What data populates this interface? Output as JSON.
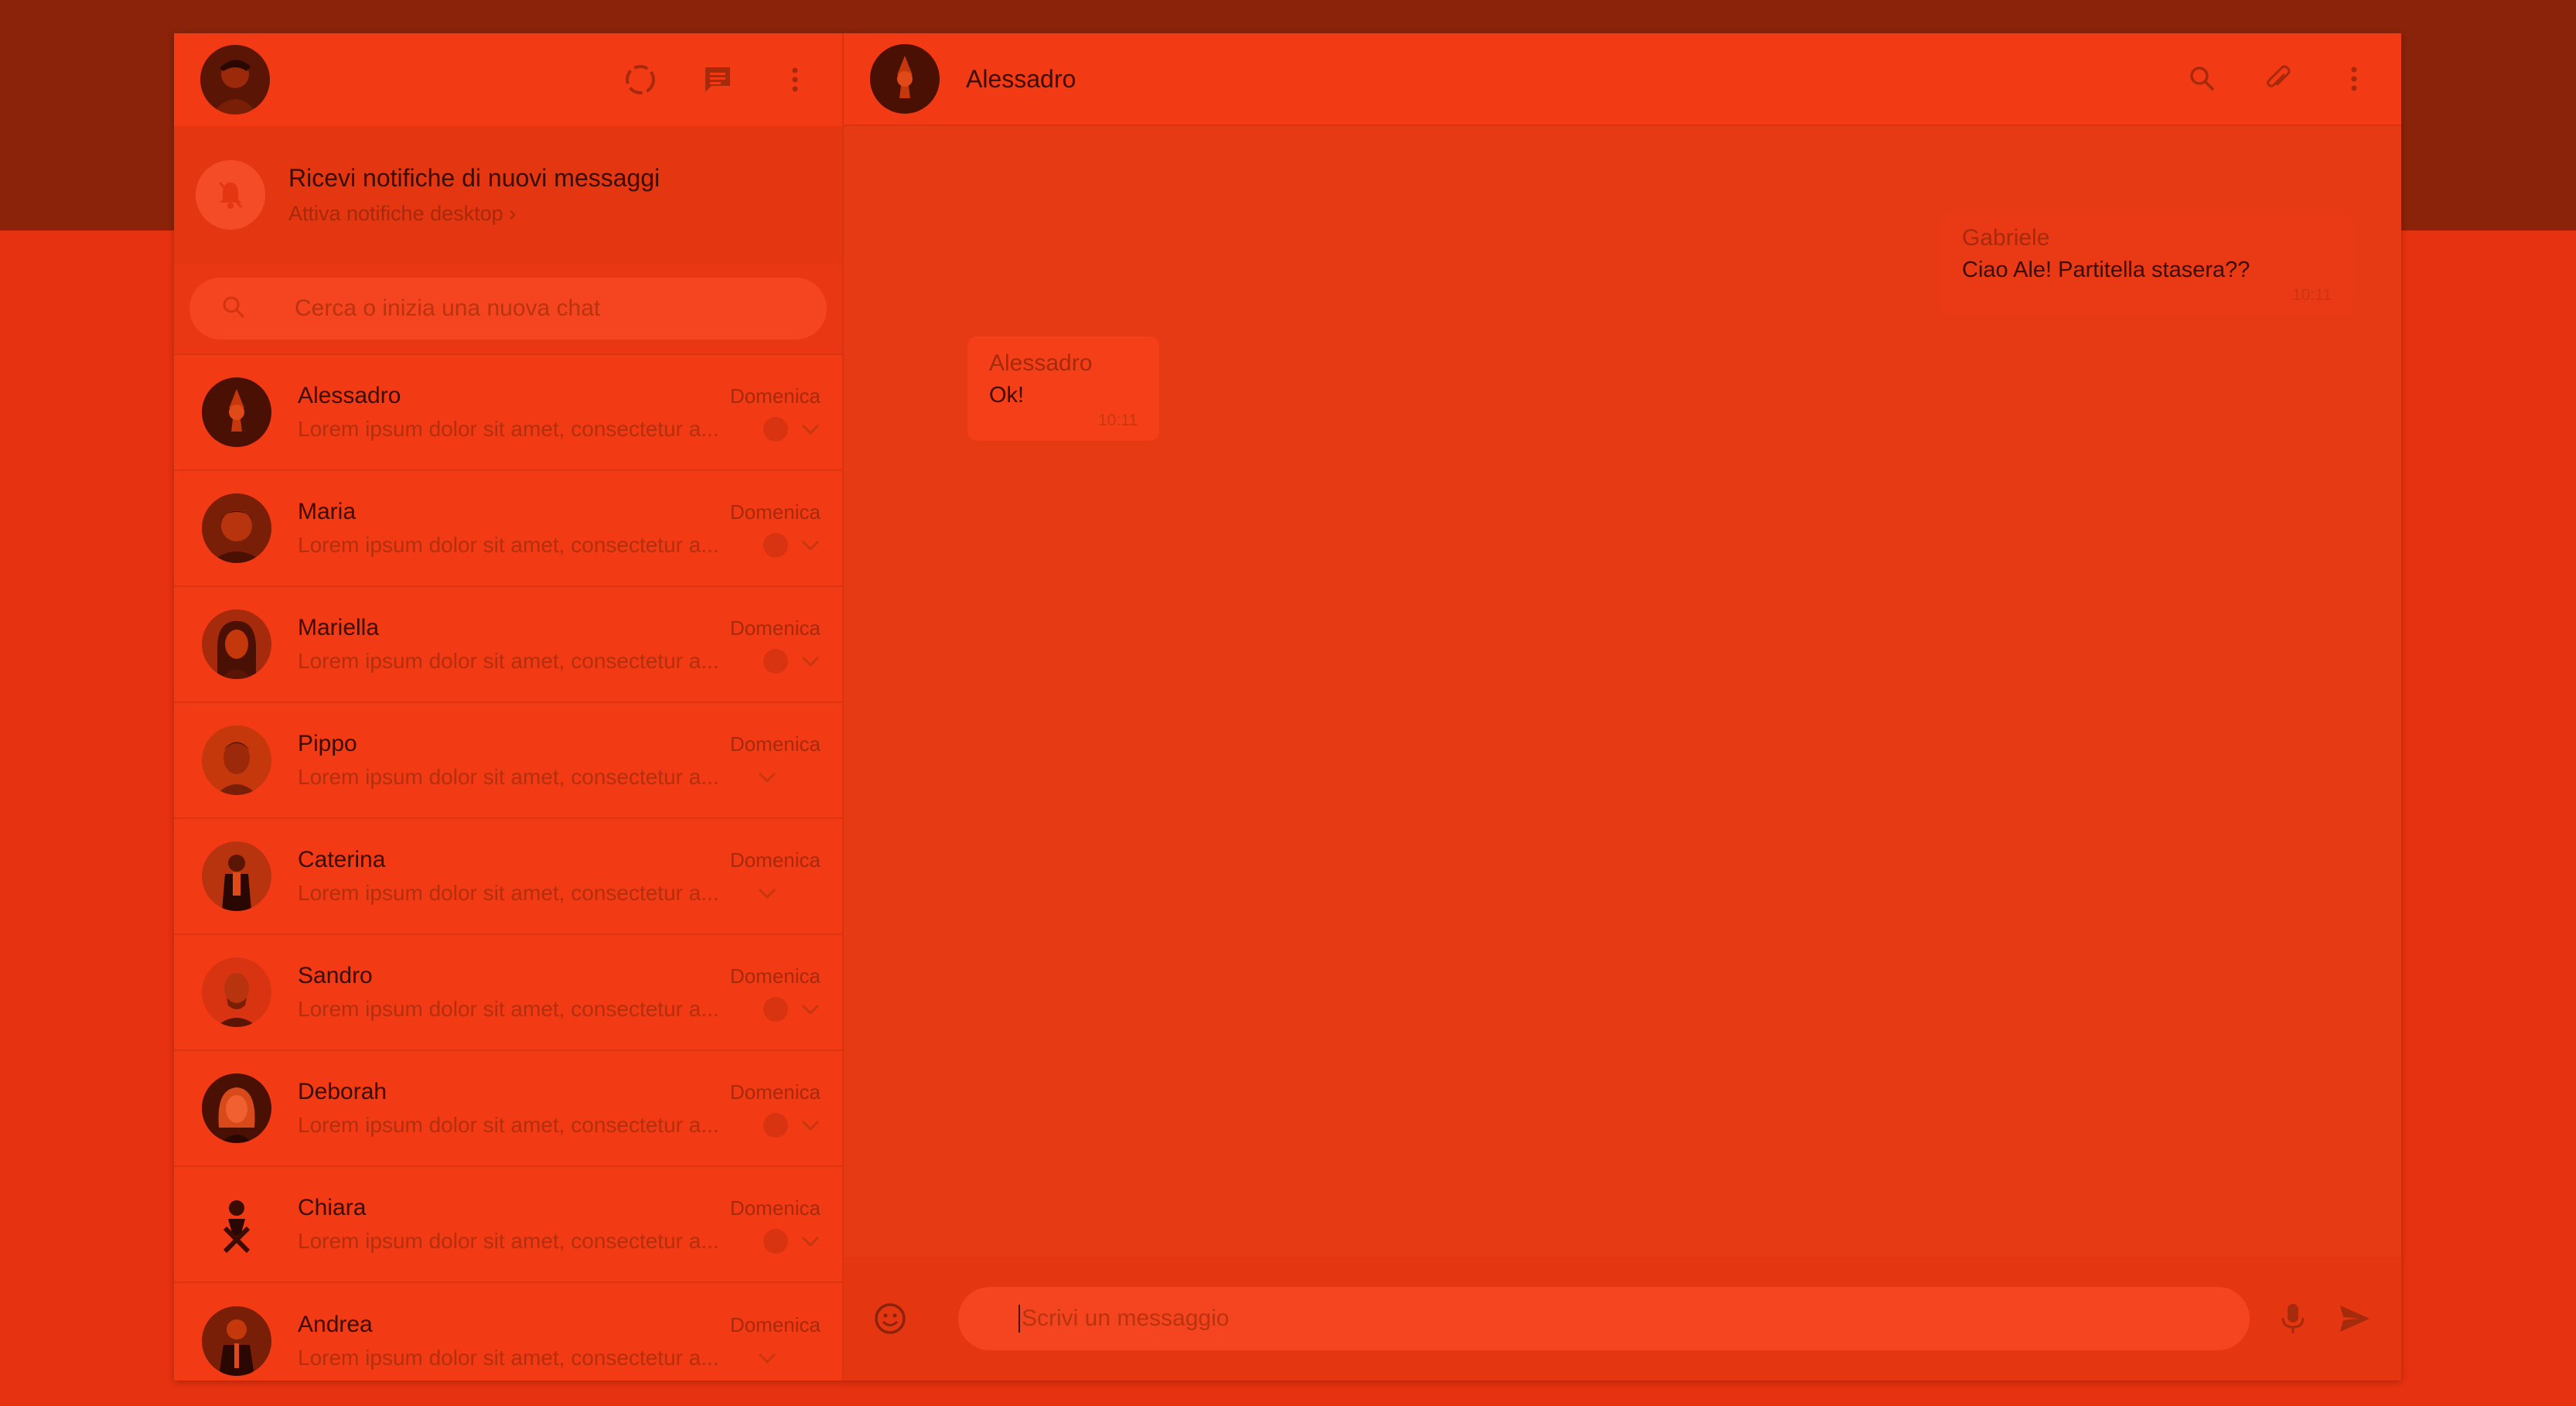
{
  "left_header": {
    "icons": [
      "status-icon",
      "new-chat-icon",
      "menu-icon"
    ]
  },
  "notification": {
    "title": "Ricevi notifiche di nuovi messaggi",
    "subtitle": "Attiva notifiche desktop ›"
  },
  "search": {
    "placeholder": "Cerca o inizia una nuova chat"
  },
  "chats": [
    {
      "name": "Alessadro",
      "time": "Domenica",
      "preview": "Lorem ipsum dolor sit amet, consectetur a..."
    },
    {
      "name": "Maria",
      "time": "Domenica",
      "preview": "Lorem ipsum dolor sit amet, consectetur a..."
    },
    {
      "name": "Mariella",
      "time": "Domenica",
      "preview": "Lorem ipsum dolor sit amet, consectetur a..."
    },
    {
      "name": "Pippo",
      "time": "Domenica",
      "preview": "Lorem ipsum dolor sit amet, consectetur a..."
    },
    {
      "name": "Caterina",
      "time": "Domenica",
      "preview": "Lorem ipsum dolor sit amet, consectetur a..."
    },
    {
      "name": "Sandro",
      "time": "Domenica",
      "preview": "Lorem ipsum dolor sit amet, consectetur a..."
    },
    {
      "name": "Deborah",
      "time": "Domenica",
      "preview": "Lorem ipsum dolor sit amet, consectetur a..."
    },
    {
      "name": "Chiara",
      "time": "Domenica",
      "preview": "Lorem ipsum dolor sit amet, consectetur a..."
    },
    {
      "name": "Andrea",
      "time": "Domenica",
      "preview": "Lorem ipsum dolor sit amet, consectetur a..."
    }
  ],
  "conversation": {
    "contact_name": "Alessadro",
    "messages": [
      {
        "sender": "Gabriele",
        "text": "Ciao Ale! Partitella stasera??",
        "time": "10:11",
        "direction": "out"
      },
      {
        "sender": "Alessadro",
        "text": "Ok!",
        "time": "10:11",
        "direction": "in"
      }
    ]
  },
  "composer": {
    "placeholder": "Scrivi un messaggio"
  },
  "colors": {
    "background": "#e63210",
    "top_band": "#8a2309",
    "panel": "#f23a14",
    "text_dark": "#3b0d02",
    "text_muted": "#a62a0c"
  }
}
